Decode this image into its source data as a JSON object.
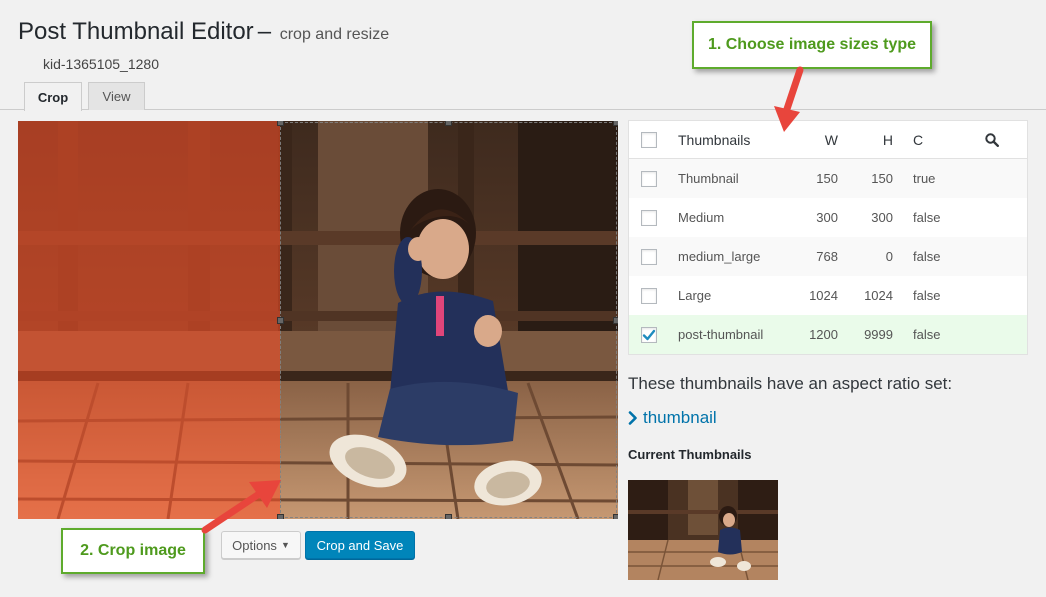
{
  "header": {
    "title": "Post Thumbnail Editor",
    "dash": "–",
    "subtitle": "crop and resize",
    "file_name": "kid-1365105_1280"
  },
  "tabs": [
    {
      "label": "Crop",
      "active": true
    },
    {
      "label": "View",
      "active": false
    }
  ],
  "editor": {
    "options_label": "Options",
    "crop_save_label": "Crop and Save"
  },
  "sizes": {
    "header": {
      "name": "Thumbnails",
      "w": "W",
      "h": "H",
      "c": "C",
      "checked": false
    },
    "rows": [
      {
        "name": "Thumbnail",
        "w": "150",
        "h": "150",
        "c": "true",
        "checked": false
      },
      {
        "name": "Medium",
        "w": "300",
        "h": "300",
        "c": "false",
        "checked": false
      },
      {
        "name": "medium_large",
        "w": "768",
        "h": "0",
        "c": "false",
        "checked": false
      },
      {
        "name": "Large",
        "w": "1024",
        "h": "1024",
        "c": "false",
        "checked": false
      },
      {
        "name": "post-thumbnail",
        "w": "1200",
        "h": "9999",
        "c": "false",
        "checked": true
      }
    ]
  },
  "aspect": {
    "note": "These thumbnails have an aspect ratio set:",
    "link": "thumbnail"
  },
  "current": {
    "heading": "Current Thumbnails"
  },
  "callouts": {
    "step1": "1. Choose image sizes type",
    "step2": "2. Crop image"
  },
  "colors": {
    "primary_button": "#0085ba",
    "link": "#0073aa",
    "callout_green": "#5eab2d",
    "arrow_red": "#e8453c",
    "selected_row": "#eafbea",
    "crop_shade": "#ff5028"
  },
  "icons": {
    "search": "search-icon",
    "link_chevron": "chevron-right-icon",
    "check": "check-icon",
    "options_caret": "caret-down-icon"
  }
}
